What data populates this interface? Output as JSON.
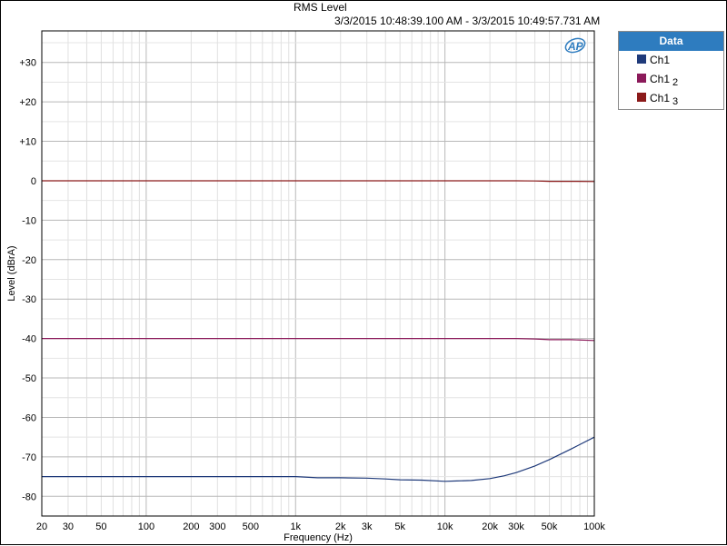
{
  "chart_data": {
    "type": "line",
    "title": "RMS Level",
    "subtitle": "3/3/2015 10:48:39.100 AM - 3/3/2015 10:49:57.731 AM",
    "xlabel": "Frequency (Hz)",
    "ylabel": "Level (dBrA)",
    "xscale": "log",
    "xlim": [
      20,
      100000
    ],
    "ylim": [
      -85,
      38
    ],
    "grid": true,
    "legend_position": "right",
    "x_ticks": [
      {
        "value": 20,
        "label": "20"
      },
      {
        "value": 30,
        "label": "30"
      },
      {
        "value": 50,
        "label": "50"
      },
      {
        "value": 100,
        "label": "100"
      },
      {
        "value": 200,
        "label": "200"
      },
      {
        "value": 300,
        "label": "300"
      },
      {
        "value": 500,
        "label": "500"
      },
      {
        "value": 1000,
        "label": "1k"
      },
      {
        "value": 2000,
        "label": "2k"
      },
      {
        "value": 3000,
        "label": "3k"
      },
      {
        "value": 5000,
        "label": "5k"
      },
      {
        "value": 10000,
        "label": "10k"
      },
      {
        "value": 20000,
        "label": "20k"
      },
      {
        "value": 30000,
        "label": "30k"
      },
      {
        "value": 50000,
        "label": "50k"
      },
      {
        "value": 100000,
        "label": "100k"
      }
    ],
    "y_ticks": [
      {
        "value": 30,
        "label": "+30"
      },
      {
        "value": 20,
        "label": "+20"
      },
      {
        "value": 10,
        "label": "+10"
      },
      {
        "value": 0,
        "label": "0"
      },
      {
        "value": -10,
        "label": "-10"
      },
      {
        "value": -20,
        "label": "-20"
      },
      {
        "value": -30,
        "label": "-30"
      },
      {
        "value": -40,
        "label": "-40"
      },
      {
        "value": -50,
        "label": "-50"
      },
      {
        "value": -60,
        "label": "-60"
      },
      {
        "value": -70,
        "label": "-70"
      },
      {
        "value": -80,
        "label": "-80"
      }
    ],
    "series": [
      {
        "name": "Ch1",
        "subscript": "",
        "color": "#1f3a7a",
        "x": [
          20,
          100,
          1000,
          1400,
          2000,
          3000,
          4000,
          5000,
          7000,
          10000,
          12000,
          15000,
          20000,
          25000,
          30000,
          40000,
          50000,
          70000,
          100000
        ],
        "y": [
          -75,
          -75,
          -75,
          -75.3,
          -75.3,
          -75.4,
          -75.6,
          -75.8,
          -75.9,
          -76.2,
          -76.1,
          -76,
          -75.5,
          -74.8,
          -74,
          -72.3,
          -70.7,
          -68,
          -65
        ]
      },
      {
        "name": "Ch1",
        "subscript": "2",
        "color": "#8b1a5a",
        "x": [
          20,
          1000,
          10000,
          30000,
          40000,
          45000,
          50000,
          70000,
          100000
        ],
        "y": [
          -40,
          -40,
          -40,
          -40,
          -40.1,
          -40.2,
          -40.3,
          -40.3,
          -40.5
        ]
      },
      {
        "name": "Ch1",
        "subscript": "3",
        "color": "#8b1a1a",
        "x": [
          20,
          1000,
          10000,
          30000,
          40000,
          45000,
          50000,
          70000,
          100000
        ],
        "y": [
          0,
          0,
          0,
          0,
          -0.05,
          -0.1,
          -0.15,
          -0.15,
          -0.2
        ]
      }
    ]
  },
  "legend": {
    "header": "Data"
  },
  "logo": {
    "text": "AP"
  }
}
